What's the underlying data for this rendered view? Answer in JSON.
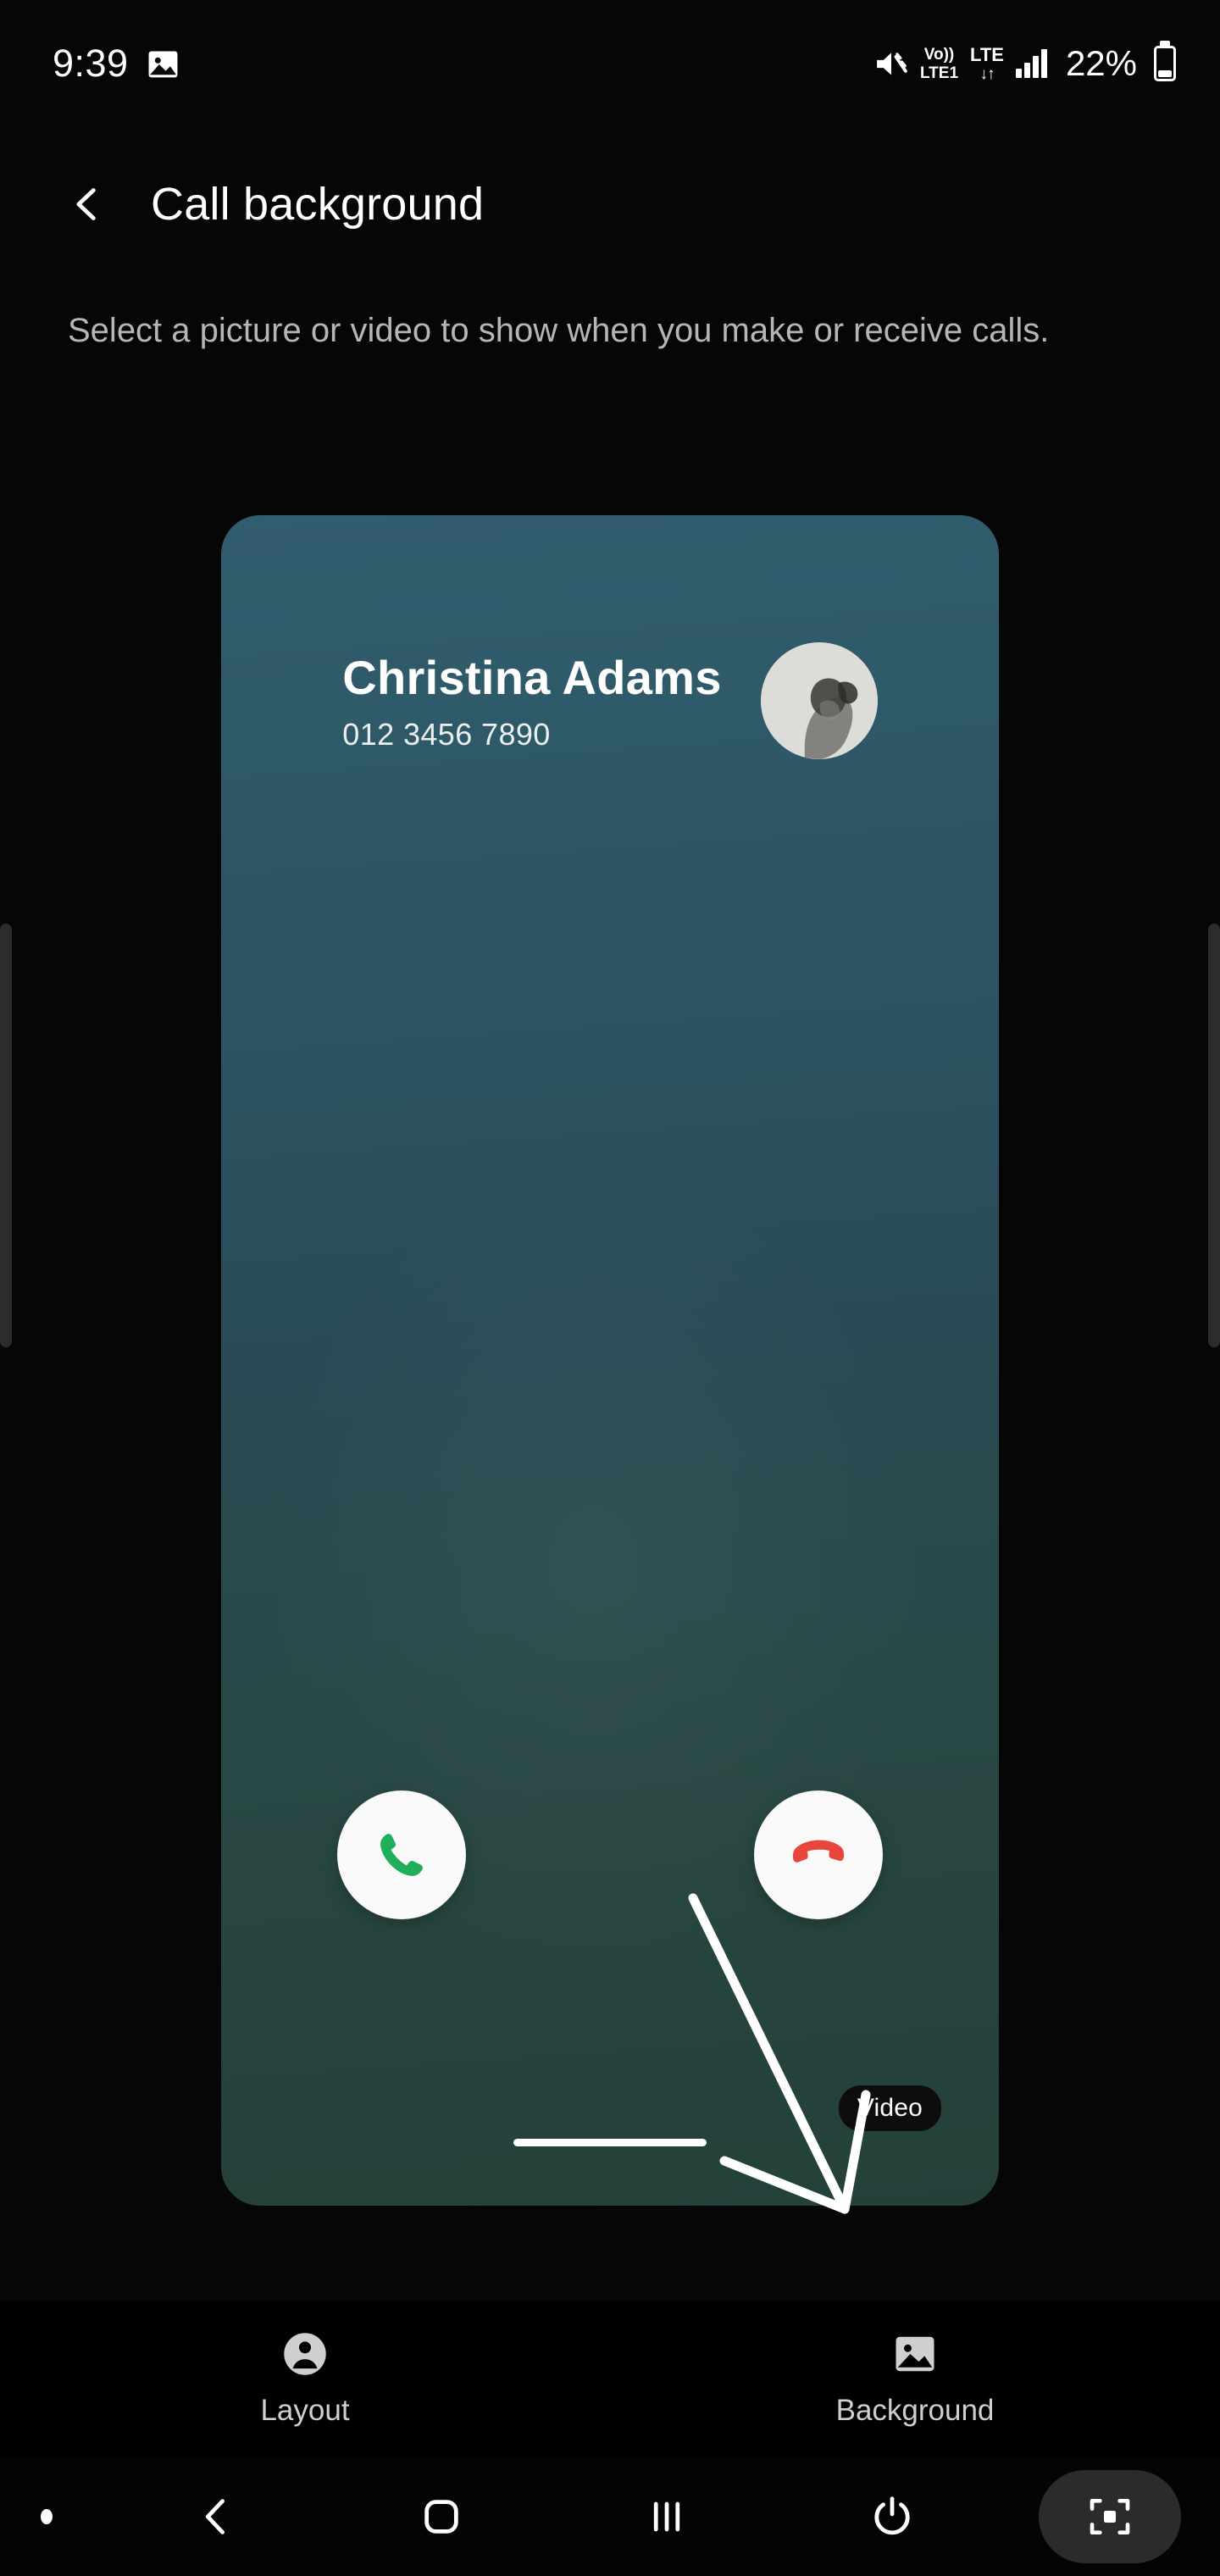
{
  "status_bar": {
    "time": "9:39",
    "gallery_icon": "gallery-icon",
    "mute_icon": "volume-mute-icon",
    "volte_top": "Vo))",
    "volte_bottom": "LTE1",
    "network_type": "LTE",
    "data_arrows": "↓↑",
    "signal_icon": "signal-bars-icon",
    "battery_percent": "22%",
    "battery_icon": "battery-icon"
  },
  "header": {
    "back_icon": "chevron-left-icon",
    "title": "Call background"
  },
  "description": "Select a picture or video to show when you make or receive calls.",
  "preview": {
    "contact_name": "Christina Adams",
    "contact_number": "012 3456 7890",
    "avatar_icon": "contact-photo-avatar",
    "accept_icon": "phone-answer-icon",
    "decline_icon": "phone-decline-icon",
    "video_badge": "Video",
    "card_gradient_top": "#325d6e",
    "card_gradient_bottom": "#234139",
    "accept_color": "#1eae5a",
    "decline_color": "#e8453c"
  },
  "tabs": [
    {
      "label": "Layout",
      "icon": "person-icon",
      "selected": false
    },
    {
      "label": "Background",
      "icon": "image-icon",
      "selected": true
    }
  ],
  "nav_bar": {
    "back_icon": "nav-back-icon",
    "home_icon": "nav-home-icon",
    "recents_icon": "nav-recents-icon",
    "power_icon": "power-icon",
    "screenshot_icon": "screenshot-capture-icon"
  }
}
